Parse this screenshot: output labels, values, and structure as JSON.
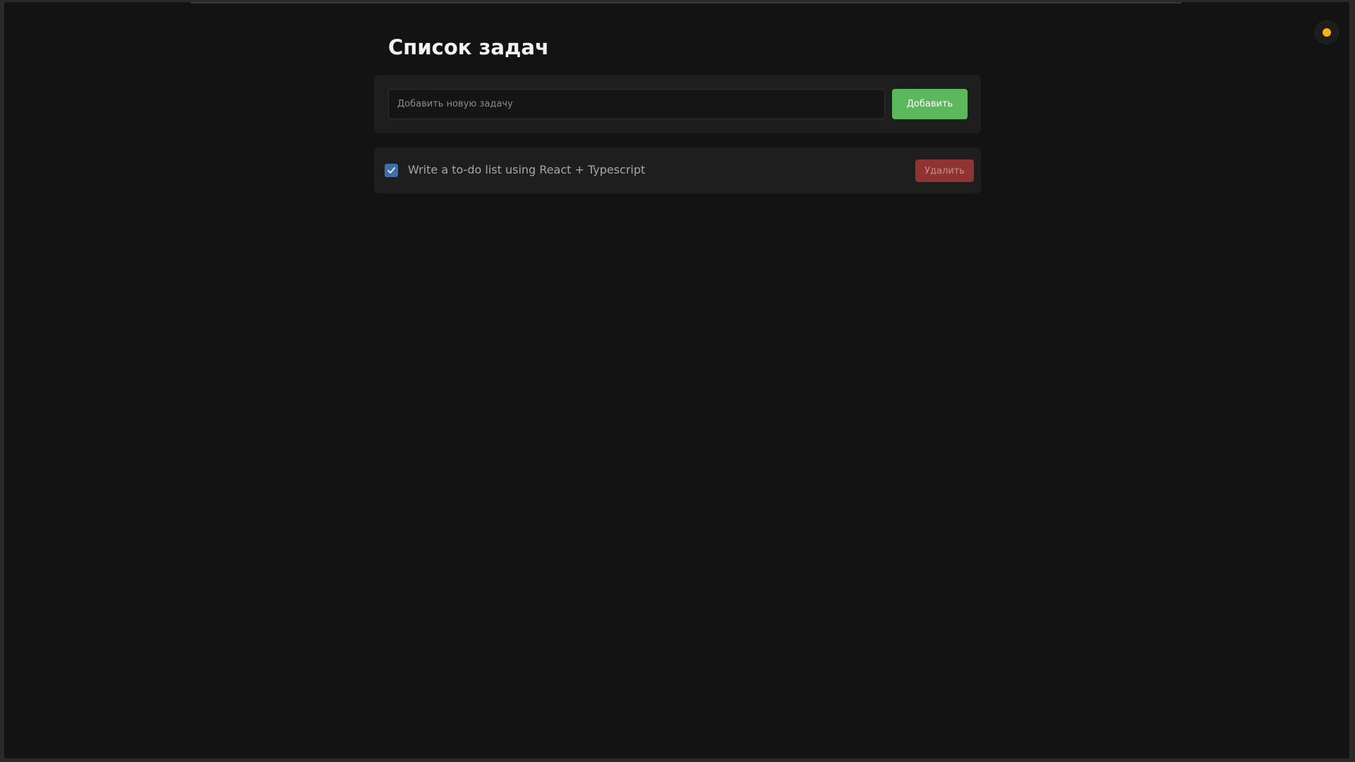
{
  "app": {
    "title": "Список задач"
  },
  "theme_toggle": {
    "icon": "sun-icon",
    "color": "#f6b21b"
  },
  "new_task": {
    "placeholder": "Добавить новую задачу",
    "value": "",
    "add_label": "Добавить",
    "add_color": "#5cb85c"
  },
  "tasks": [
    {
      "text": "Write a to-do list using React + Typescript",
      "completed": true,
      "delete_label": "Удалить",
      "delete_color": "#8f3333"
    }
  ]
}
